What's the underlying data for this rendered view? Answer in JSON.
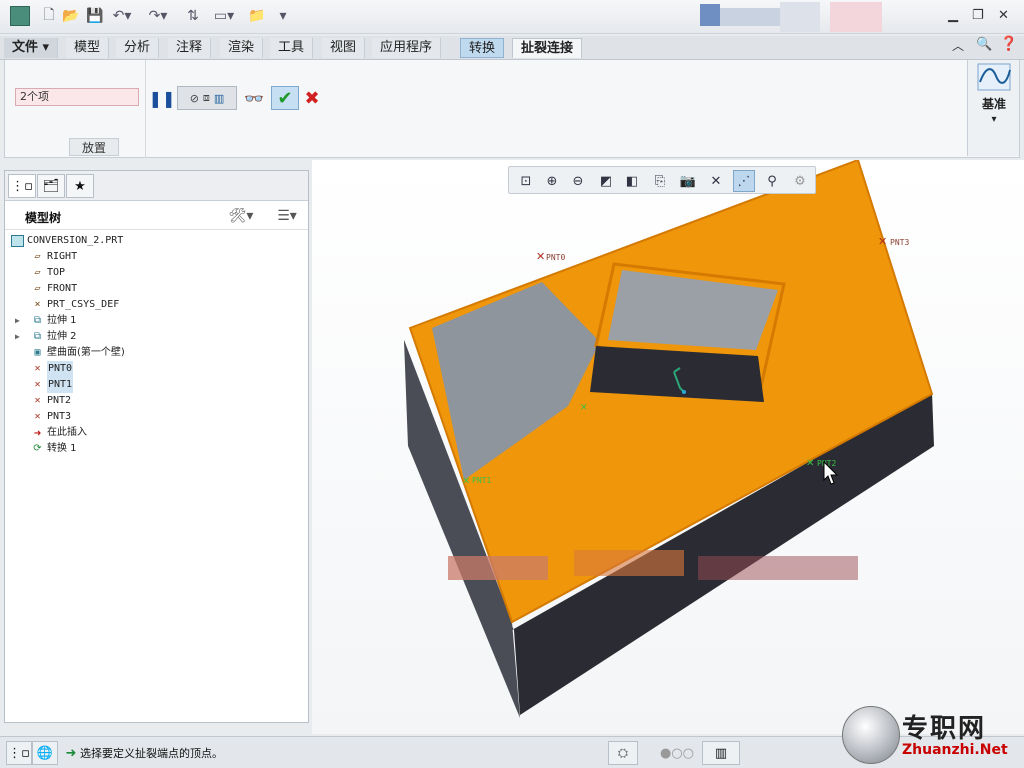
{
  "ribbon_tabs": [
    {
      "label": "文件 ▾"
    },
    {
      "label": "模型"
    },
    {
      "label": "分析"
    },
    {
      "label": "注释"
    },
    {
      "label": "渲染"
    },
    {
      "label": "工具"
    },
    {
      "label": "视图"
    },
    {
      "label": "应用程序"
    },
    {
      "label": "转换"
    },
    {
      "label": "扯裂连接"
    }
  ],
  "ribbon": {
    "collector_value": "2个项",
    "group_label": "放置",
    "datum_label": "基准",
    "datum_arrow": "▾"
  },
  "model_tree": {
    "title": "模型树",
    "items": [
      {
        "label": "CONVERSION_2.PRT",
        "icon": "part-icon"
      },
      {
        "label": "RIGHT",
        "icon": "datum-plane-icon"
      },
      {
        "label": "TOP",
        "icon": "datum-plane-icon"
      },
      {
        "label": "FRONT",
        "icon": "datum-plane-icon"
      },
      {
        "label": "PRT_CSYS_DEF",
        "icon": "csys-icon"
      },
      {
        "label": "拉伸 1",
        "icon": "extrude-icon"
      },
      {
        "label": "拉伸 2",
        "icon": "extrude-icon"
      },
      {
        "label": "壁曲面(第一个壁)",
        "icon": "wall-surface-icon"
      },
      {
        "label": "PNT0",
        "icon": "datum-point-icon"
      },
      {
        "label": "PNT1",
        "icon": "datum-point-icon"
      },
      {
        "label": "PNT2",
        "icon": "datum-point-icon"
      },
      {
        "label": "PNT3",
        "icon": "datum-point-icon"
      },
      {
        "label": "在此插入",
        "icon": "insert-here-icon"
      },
      {
        "label": "转换 1",
        "icon": "conversion-icon"
      }
    ]
  },
  "viewport": {
    "points": [
      {
        "label": "PNT0"
      },
      {
        "label": "PNT1"
      },
      {
        "label": "PNT2"
      },
      {
        "label": "PNT3"
      }
    ]
  },
  "status": {
    "message": "选择要定义扯裂端点的顶点。"
  },
  "watermark": {
    "text": "专职网",
    "url": "Zhuanzhi.Net"
  },
  "colors": {
    "part_face": "#f0960a",
    "part_side": "#2b2c33",
    "gray_face": "#8e959c",
    "tab_active": "#bfd9ee",
    "confirm": "#1f9a2a",
    "cancel": "#d02020"
  }
}
